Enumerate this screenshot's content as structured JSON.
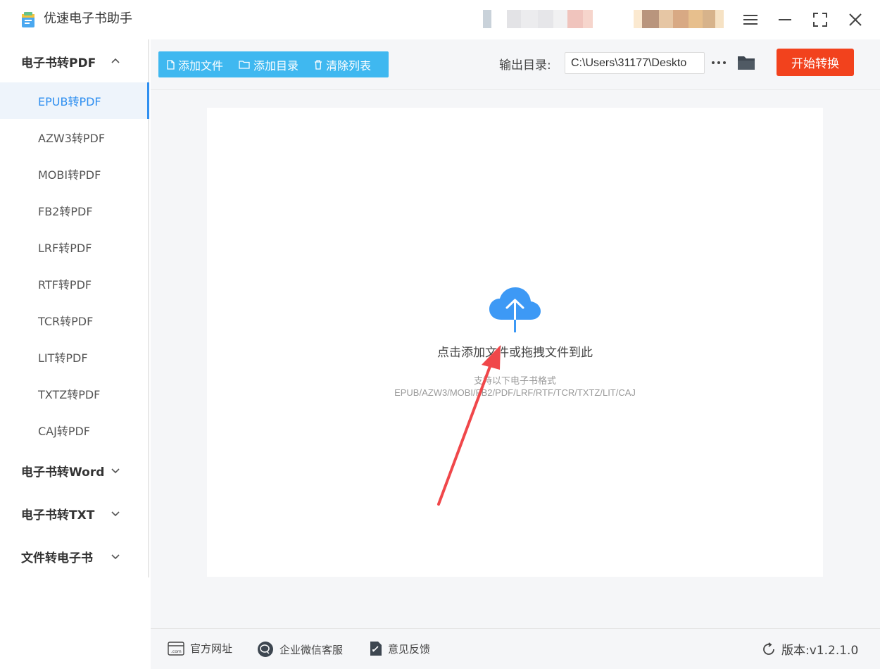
{
  "app": {
    "title": "优速电子书助手"
  },
  "sidebar": {
    "groups": [
      {
        "label": "电子书转PDF",
        "expanded": true,
        "items": [
          "EPUB转PDF",
          "AZW3转PDF",
          "MOBI转PDF",
          "FB2转PDF",
          "LRF转PDF",
          "RTF转PDF",
          "TCR转PDF",
          "LIT转PDF",
          "TXTZ转PDF",
          "CAJ转PDF"
        ],
        "active_index": 0
      },
      {
        "label": "电子书转Word",
        "expanded": false
      },
      {
        "label": "电子书转TXT",
        "expanded": false
      },
      {
        "label": "文件转电子书",
        "expanded": false
      }
    ]
  },
  "toolbar": {
    "add_file": "添加文件",
    "add_dir": "添加目录",
    "clear_list": "清除列表",
    "output_label": "输出目录:",
    "output_path": "C:\\Users\\31177\\Deskto",
    "start": "开始转换"
  },
  "dropzone": {
    "hint": "点击添加文件或拖拽文件到此",
    "support_title": "支持以下电子书格式",
    "support_formats": "EPUB/AZW3/MOBI/FB2/PDF/LRF/RTF/TCR/TXTZ/LIT/CAJ"
  },
  "footer": {
    "website": "官方网址",
    "wechat": "企业微信客服",
    "feedback": "意见反馈",
    "version": "版本:v1.2.1.0"
  },
  "colors": {
    "accent_blue": "#3fb8f0",
    "active_blue": "#2f8ff0",
    "start_red": "#f2421d",
    "arrow_red": "#f0474a"
  },
  "icons": [
    "book-logo-icon",
    "menu-icon",
    "minimize-icon",
    "fullscreen-icon",
    "close-icon",
    "file-icon",
    "folder-outline-icon",
    "trash-icon",
    "more-dots-icon",
    "folder-icon",
    "cloud-upload-icon",
    "website-icon",
    "wechat-icon",
    "feedback-icon",
    "refresh-icon",
    "chevron-up-icon",
    "chevron-down-icon"
  ]
}
